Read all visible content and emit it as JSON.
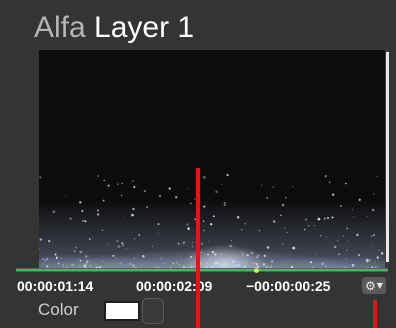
{
  "header": {
    "prefix": "Alfa",
    "layer_name": "Layer 1"
  },
  "viewer": {
    "content": "particle-preview"
  },
  "timeline": {
    "current_time": "00:00:01:14",
    "playhead_time": "00:00:02:09",
    "remaining_time": "−00:00:00:25",
    "progress_color": "#3bbf55",
    "marker_color": "#d6e64a"
  },
  "settings": {
    "icon": "gear-icon",
    "dropdown_icon": "caret-down-icon"
  },
  "color_row": {
    "label": "Color",
    "swatch_color": "#ffffff"
  },
  "annotations": {
    "line_color": "#e51414"
  }
}
